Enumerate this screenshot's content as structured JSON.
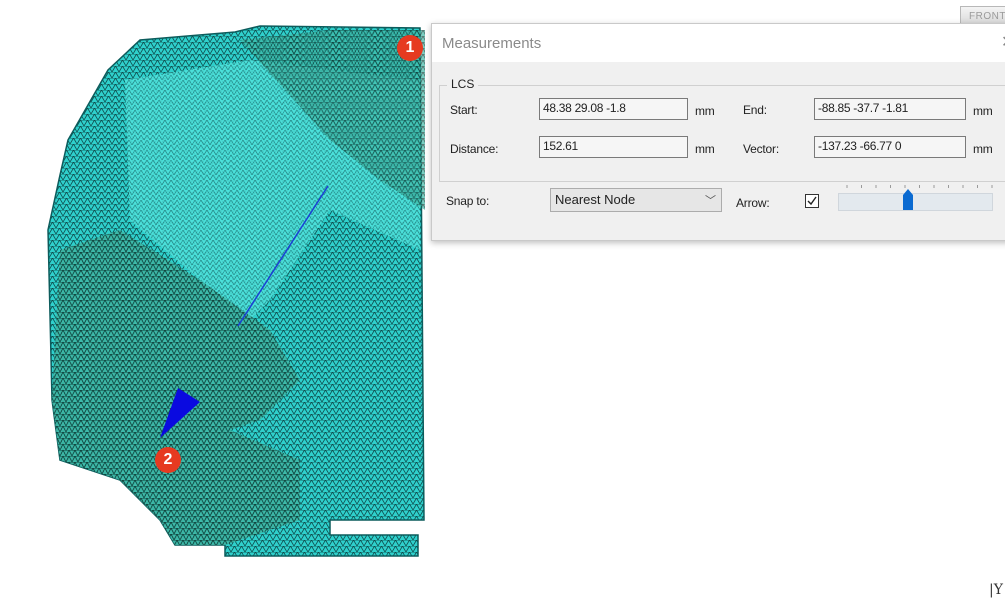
{
  "viewport": {
    "markers": [
      "1",
      "2"
    ],
    "viewcube_face": "FRONT",
    "axis_label": "|Y",
    "mesh_color": "#2cc7c7",
    "measure_line_color": "#1a3fd6",
    "arrow_color": "#0a0ae0"
  },
  "dialog": {
    "title": "Measurements",
    "close_icon": "close-icon",
    "group_title": "LCS",
    "start_label": "Start:",
    "start_value": "48.38 29.08 -1.8",
    "start_unit": "mm",
    "end_label": "End:",
    "end_value": "-88.85 -37.7 -1.81",
    "end_unit": "mm",
    "distance_label": "Distance:",
    "distance_value": "152.61",
    "distance_unit": "mm",
    "vector_label": "Vector:",
    "vector_value": "-137.23 -66.77 0",
    "vector_unit": "mm",
    "snap_label": "Snap to:",
    "snap_value": "Nearest Node",
    "arrow_label": "Arrow:",
    "arrow_checked": "✓",
    "arrow_size_level": 0.45,
    "accent": "#0a6ad1"
  }
}
